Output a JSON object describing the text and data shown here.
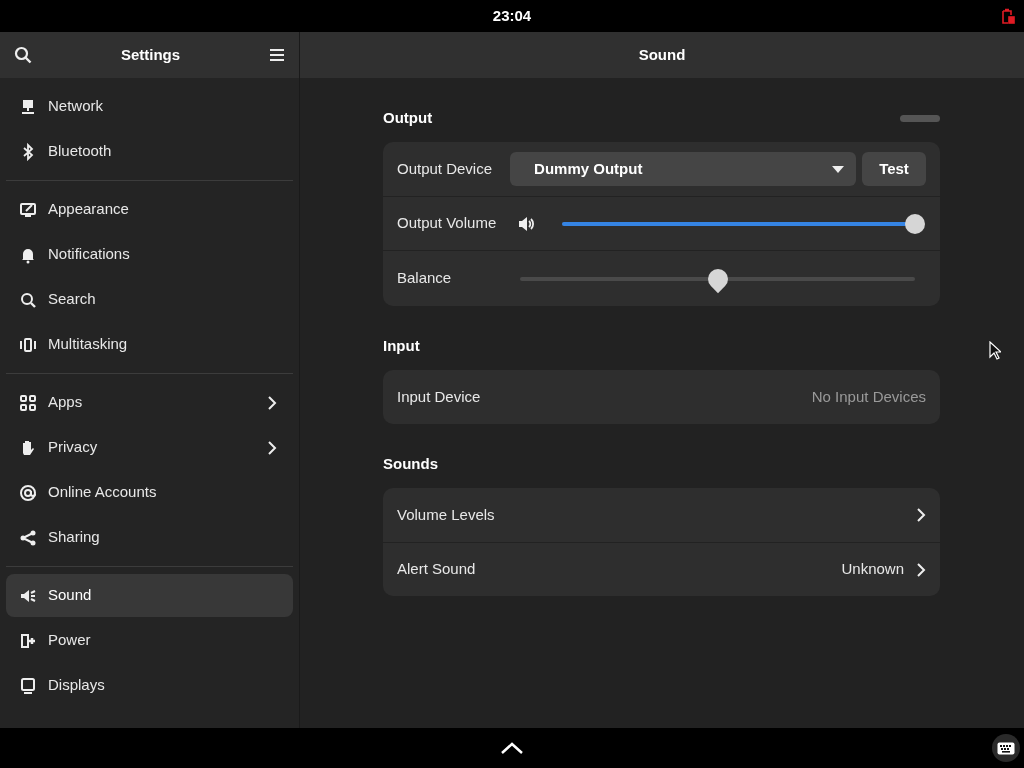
{
  "top_bar": {
    "clock": "23:04"
  },
  "sidebar": {
    "title": "Settings",
    "groups": [
      [
        {
          "label": "Network",
          "arrow": false,
          "selected": false
        },
        {
          "label": "Bluetooth",
          "arrow": false,
          "selected": false
        }
      ],
      [
        {
          "label": "Appearance",
          "arrow": false,
          "selected": false
        },
        {
          "label": "Notifications",
          "arrow": false,
          "selected": false
        },
        {
          "label": "Search",
          "arrow": false,
          "selected": false
        },
        {
          "label": "Multitasking",
          "arrow": false,
          "selected": false
        }
      ],
      [
        {
          "label": "Apps",
          "arrow": true,
          "selected": false
        },
        {
          "label": "Privacy",
          "arrow": true,
          "selected": false
        },
        {
          "label": "Online Accounts",
          "arrow": false,
          "selected": false
        },
        {
          "label": "Sharing",
          "arrow": false,
          "selected": false
        }
      ],
      [
        {
          "label": "Sound",
          "arrow": false,
          "selected": true
        },
        {
          "label": "Power",
          "arrow": false,
          "selected": false
        },
        {
          "label": "Displays",
          "arrow": false,
          "selected": false
        }
      ]
    ]
  },
  "main": {
    "title": "Sound",
    "sections": [
      {
        "title": "Output",
        "rows": [
          {
            "kind": "device",
            "label": "Output Device",
            "value": "Dummy Output",
            "button": "Test"
          },
          {
            "kind": "volume",
            "label": "Output Volume",
            "level": 1.0
          },
          {
            "kind": "balance",
            "label": "Balance",
            "level": 0.5
          }
        ]
      },
      {
        "title": "Input",
        "rows": [
          {
            "kind": "info",
            "label": "Input Device",
            "value": "No Input Devices"
          }
        ]
      },
      {
        "title": "Sounds",
        "rows": [
          {
            "kind": "link",
            "label": "Volume Levels"
          },
          {
            "kind": "link",
            "label": "Alert Sound",
            "value": "Unknown"
          }
        ]
      }
    ]
  }
}
